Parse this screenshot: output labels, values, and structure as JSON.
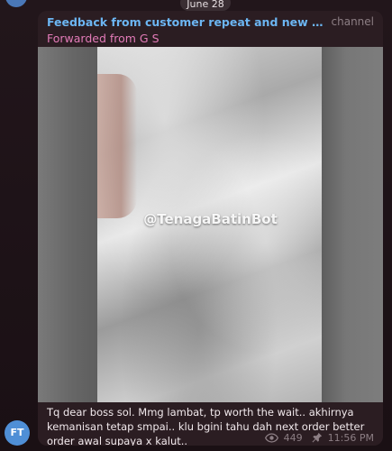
{
  "date_separator": "June 28",
  "message": {
    "forwarded_title": "Feedback from customer repeat and new buuyer #thai...",
    "forwarded_tag": "channel",
    "forwarded_from": "Forwarded from G S",
    "media_watermark": "@TenagaBatinBot",
    "caption": "Tq dear boss sol. Mmg lambat, tp worth the wait.. akhirnya kemanisan tetap smpai.. klu bgini tahu dah next order better order awal supaya x kalut..",
    "views": "449",
    "time": "11:56 PM",
    "views_icon": "eye-icon",
    "pin_icon": "pin-icon"
  },
  "sender_avatar": {
    "initials": "FT",
    "color": "#4f8fd6"
  },
  "colors": {
    "title_blue": "#6cb6f3",
    "forwarded_pink": "#e37bb8",
    "bubble_bg": "#2b1d22"
  }
}
